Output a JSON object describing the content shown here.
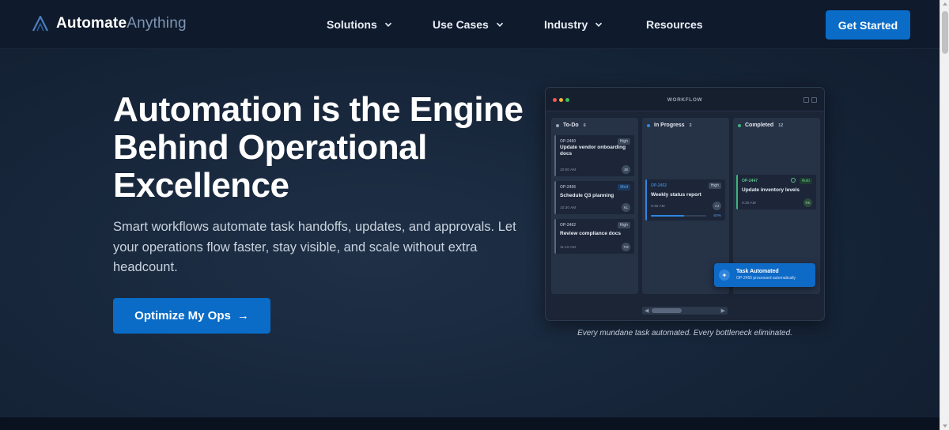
{
  "brand": {
    "name_part1": "Automate",
    "name_part2": "Anything",
    "logo_icon": "a-logo-icon"
  },
  "nav": {
    "items": [
      {
        "label": "Solutions",
        "has_dropdown": true
      },
      {
        "label": "Use Cases",
        "has_dropdown": true
      },
      {
        "label": "Industry",
        "has_dropdown": true
      },
      {
        "label": "Resources",
        "has_dropdown": false
      }
    ],
    "cta_label": "Get Started"
  },
  "hero": {
    "title": "Automation is the Engine Behind Operational Excellence",
    "subtitle": "Smart workflows automate task handoffs, updates, and approvals. Let your operations flow faster, stay visible, and scale without extra headcount.",
    "button_label": "Optimize My Ops",
    "button_icon": "arrow-right-icon"
  },
  "workflow": {
    "title": "WORKFLOW",
    "columns": [
      {
        "name": "To-Do",
        "count": "6",
        "color": "#9aa6b8",
        "cards": [
          {
            "id": "OP-2460",
            "title": "Update vendor onboarding docs",
            "time": "10:00 AM",
            "priority": "High",
            "avatar": "JB"
          },
          {
            "id": "OP-2456",
            "title": "Schedule Q3 planning",
            "time": "10:30 AM",
            "priority": "Med",
            "avatar": "KL"
          },
          {
            "id": "OP-2462",
            "title": "Review compliance docs",
            "time": "11:15 AM",
            "priority": "High",
            "avatar": "TM"
          }
        ]
      },
      {
        "name": "In Progress",
        "count": "3",
        "color": "#2f86e0",
        "cards": [
          {
            "id": "OP-2452",
            "title": "Weekly status report",
            "time": "9:45 AM",
            "priority": "High",
            "avatar": "AJ",
            "progress_label": "60%",
            "progress": 0.6
          }
        ]
      },
      {
        "name": "Completed",
        "count": "12",
        "color": "#3fb37a",
        "cards": [
          {
            "id": "OP-2447",
            "title": "Update inventory levels",
            "time": "9:30 AM",
            "priority": "Auto",
            "avatar": "RK"
          }
        ]
      }
    ],
    "toast": {
      "title": "Task Automated",
      "message": "OP-2455 processed automatically"
    }
  },
  "caption": "Every mundane task automated. Every bottleneck eliminated.",
  "colors": {
    "accent": "#0a6cc7",
    "background": "#17263a",
    "header": "#0f1a2c"
  }
}
